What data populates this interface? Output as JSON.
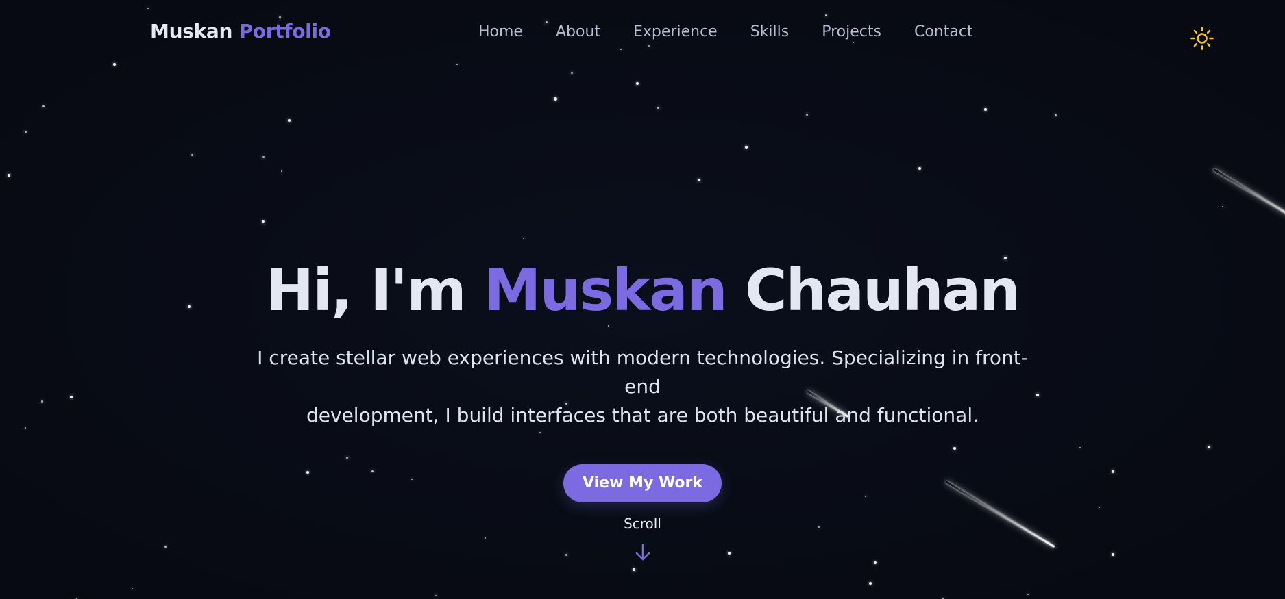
{
  "colors": {
    "background": "#090c16",
    "accent": "#7c6be0",
    "text": "#e4e7f2",
    "nav_text": "#b7bdd0",
    "sun_icon": "#f5c518"
  },
  "navbar": {
    "logo_primary": "Muskan",
    "logo_accent": "Portfolio",
    "links": [
      {
        "label": "Home"
      },
      {
        "label": "About"
      },
      {
        "label": "Experience"
      },
      {
        "label": "Skills"
      },
      {
        "label": "Projects"
      },
      {
        "label": "Contact"
      }
    ],
    "theme_toggle_icon": "sun-icon"
  },
  "hero": {
    "greeting": "Hi, I'm",
    "name_first": "Muskan",
    "name_last": "Chauhan",
    "subtitle_line1": "I create stellar web experiences with modern technologies. Specializing in front-end",
    "subtitle_line2": "development, I build interfaces that are both beautiful and functional.",
    "cta_label": "View My Work"
  },
  "scroll": {
    "label": "Scroll",
    "icon": "arrow-down-icon"
  }
}
